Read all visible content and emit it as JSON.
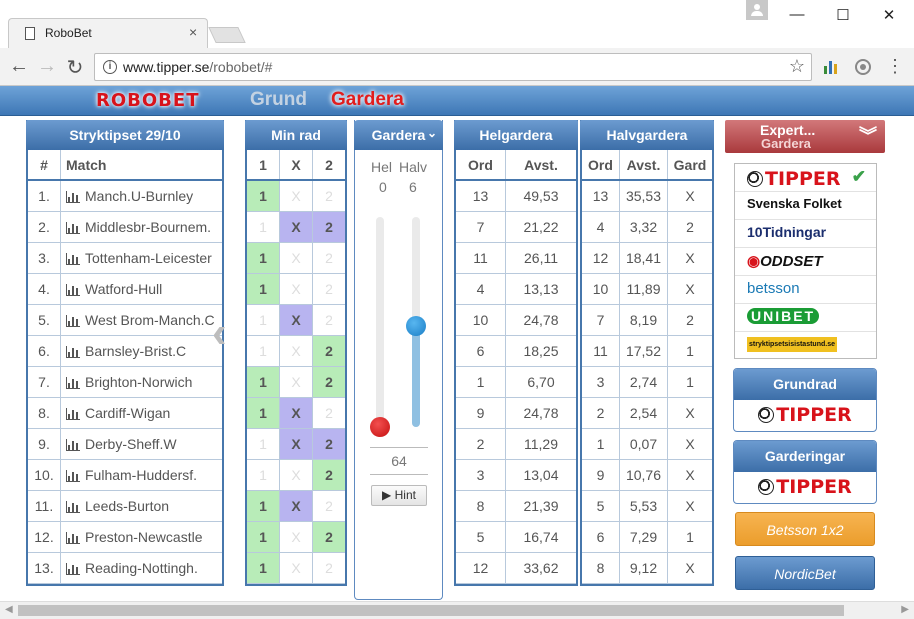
{
  "browser": {
    "tab_title": "RoboBet",
    "tab_close": "×",
    "url_host": "www.tipper.se",
    "url_path": "/robobet/#",
    "win_min": "—",
    "win_max": "☐",
    "win_close": "✕"
  },
  "header": {
    "logo": "ROBOBET",
    "nav_grund": "Grund",
    "nav_gardera": "Gardera"
  },
  "stryktipset": {
    "title": "Stryktipset 29/10",
    "col_num": "#",
    "col_match": "Match",
    "matches": [
      {
        "num": "1.",
        "name": "Manch.U-Burnley"
      },
      {
        "num": "2.",
        "name": "Middlesbr-Bournem."
      },
      {
        "num": "3.",
        "name": "Tottenham-Leicester"
      },
      {
        "num": "4.",
        "name": "Watford-Hull"
      },
      {
        "num": "5.",
        "name": "West Brom-Manch.C"
      },
      {
        "num": "6.",
        "name": "Barnsley-Brist.C"
      },
      {
        "num": "7.",
        "name": "Brighton-Norwich"
      },
      {
        "num": "8.",
        "name": "Cardiff-Wigan"
      },
      {
        "num": "9.",
        "name": "Derby-Sheff.W"
      },
      {
        "num": "10.",
        "name": "Fulham-Huddersf."
      },
      {
        "num": "11.",
        "name": "Leeds-Burton"
      },
      {
        "num": "12.",
        "name": "Preston-Newcastle"
      },
      {
        "num": "13.",
        "name": "Reading-Nottingh."
      }
    ]
  },
  "minrad": {
    "title": "Min rad",
    "cols": [
      "1",
      "X",
      "2"
    ],
    "rows": [
      [
        true,
        false,
        false
      ],
      [
        false,
        true,
        true
      ],
      [
        true,
        false,
        false
      ],
      [
        true,
        false,
        false
      ],
      [
        false,
        true,
        false
      ],
      [
        false,
        false,
        true
      ],
      [
        true,
        false,
        true
      ],
      [
        true,
        true,
        false
      ],
      [
        false,
        true,
        true
      ],
      [
        false,
        false,
        true
      ],
      [
        true,
        true,
        false
      ],
      [
        true,
        false,
        true
      ],
      [
        true,
        false,
        false
      ]
    ]
  },
  "gardera": {
    "title": "Gardera",
    "hel_label": "Hel",
    "halv_label": "Halv",
    "hel_value": "0",
    "halv_value": "6",
    "hel_level": 0,
    "halv_level": 0.48,
    "total": "64",
    "hint": "▶ Hint"
  },
  "helgardera": {
    "title": "Helgardera",
    "col_ord": "Ord",
    "col_avst": "Avst.",
    "rows": [
      [
        "13",
        "49,53"
      ],
      [
        "7",
        "21,22"
      ],
      [
        "11",
        "26,11"
      ],
      [
        "4",
        "13,13"
      ],
      [
        "10",
        "24,78"
      ],
      [
        "6",
        "18,25"
      ],
      [
        "1",
        "6,70"
      ],
      [
        "9",
        "24,78"
      ],
      [
        "2",
        "11,29"
      ],
      [
        "3",
        "13,04"
      ],
      [
        "8",
        "21,39"
      ],
      [
        "5",
        "16,74"
      ],
      [
        "12",
        "33,62"
      ]
    ]
  },
  "halvgardera": {
    "title": "Halvgardera",
    "col_ord": "Ord",
    "col_avst": "Avst.",
    "col_gard": "Gard",
    "rows": [
      [
        "13",
        "35,53",
        "X"
      ],
      [
        "4",
        "3,32",
        "2"
      ],
      [
        "12",
        "18,41",
        "X"
      ],
      [
        "10",
        "11,89",
        "X"
      ],
      [
        "7",
        "8,19",
        "2"
      ],
      [
        "11",
        "17,52",
        "1"
      ],
      [
        "3",
        "2,74",
        "1"
      ],
      [
        "2",
        "2,54",
        "X"
      ],
      [
        "1",
        "0,07",
        "X"
      ],
      [
        "9",
        "10,76",
        "X"
      ],
      [
        "5",
        "5,53",
        "X"
      ],
      [
        "6",
        "7,29",
        "1"
      ],
      [
        "8",
        "9,12",
        "X"
      ]
    ]
  },
  "sidebar": {
    "expert_line1": "Expert...",
    "expert_line2": "Gardera",
    "bookmakers": [
      "TIPPER",
      "Svenska Folket",
      "10Tidningar",
      "ODDSET",
      "betsson",
      "UNIBET",
      "stryktipsetsisistastund.se"
    ],
    "check": "✔",
    "grundrad_title": "Grundrad",
    "grundrad_logo": "TIPPER",
    "garderingar_title": "Garderingar",
    "garderingar_logo": "TIPPER",
    "betsson_button": "Betsson 1x2",
    "nordicbet_button": "NordicBet"
  }
}
